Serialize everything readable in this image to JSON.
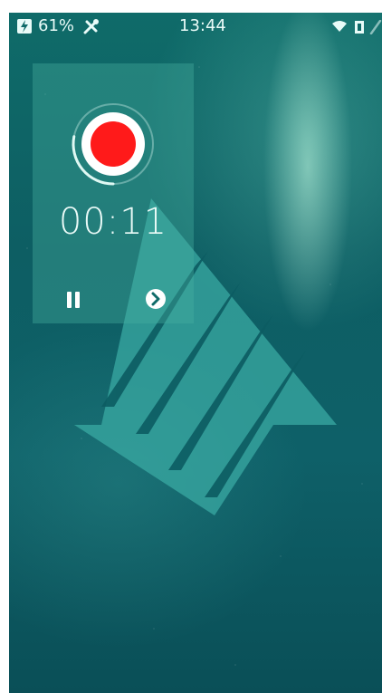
{
  "status_bar": {
    "battery_percent": "61%",
    "time": "13:44",
    "icons": [
      "battery-charging-icon",
      "tools-icon",
      "wifi-icon",
      "sim-card-icon",
      "extra-status-icon"
    ]
  },
  "recorder": {
    "timer": "00:11",
    "recording_progress": 0.28,
    "colors": {
      "record": "#ff1a1a",
      "ring": "#dff8f3"
    },
    "controls": [
      "pause-icon",
      "next-icon"
    ]
  }
}
